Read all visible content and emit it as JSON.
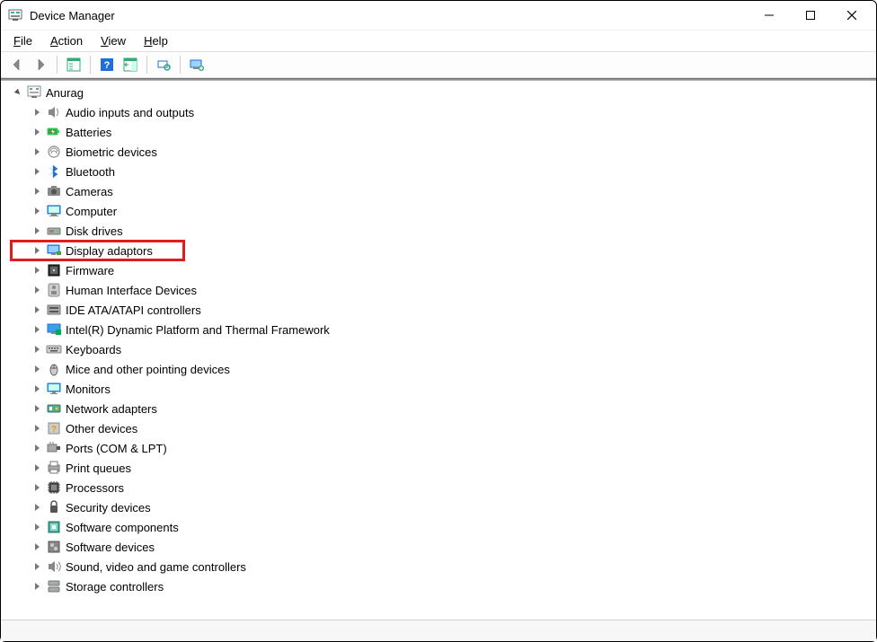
{
  "window": {
    "title": "Device Manager"
  },
  "menubar": {
    "file": "File",
    "action": "Action",
    "view": "View",
    "help": "Help"
  },
  "root": {
    "expanded": true,
    "label": "Anurag",
    "icon": "computer-root-icon"
  },
  "categories": [
    {
      "label": "Audio inputs and outputs",
      "icon": "audio-icon",
      "highlighted": false
    },
    {
      "label": "Batteries",
      "icon": "battery-icon",
      "highlighted": false
    },
    {
      "label": "Biometric devices",
      "icon": "biometric-icon",
      "highlighted": false
    },
    {
      "label": "Bluetooth",
      "icon": "bluetooth-icon",
      "highlighted": false
    },
    {
      "label": "Cameras",
      "icon": "camera-icon",
      "highlighted": false
    },
    {
      "label": "Computer",
      "icon": "computer-icon",
      "highlighted": false
    },
    {
      "label": "Disk drives",
      "icon": "disk-icon",
      "highlighted": false
    },
    {
      "label": "Display adaptors",
      "icon": "display-icon",
      "highlighted": true
    },
    {
      "label": "Firmware",
      "icon": "firmware-icon",
      "highlighted": false
    },
    {
      "label": "Human Interface Devices",
      "icon": "hid-icon",
      "highlighted": false
    },
    {
      "label": "IDE ATA/ATAPI controllers",
      "icon": "ide-icon",
      "highlighted": false
    },
    {
      "label": "Intel(R) Dynamic Platform and Thermal Framework",
      "icon": "intel-icon",
      "highlighted": false
    },
    {
      "label": "Keyboards",
      "icon": "keyboard-icon",
      "highlighted": false
    },
    {
      "label": "Mice and other pointing devices",
      "icon": "mouse-icon",
      "highlighted": false
    },
    {
      "label": "Monitors",
      "icon": "monitor-icon",
      "highlighted": false
    },
    {
      "label": "Network adapters",
      "icon": "network-icon",
      "highlighted": false
    },
    {
      "label": "Other devices",
      "icon": "other-icon",
      "highlighted": false
    },
    {
      "label": "Ports (COM & LPT)",
      "icon": "port-icon",
      "highlighted": false
    },
    {
      "label": "Print queues",
      "icon": "printer-icon",
      "highlighted": false
    },
    {
      "label": "Processors",
      "icon": "cpu-icon",
      "highlighted": false
    },
    {
      "label": "Security devices",
      "icon": "security-icon",
      "highlighted": false
    },
    {
      "label": "Software components",
      "icon": "software-comp-icon",
      "highlighted": false
    },
    {
      "label": "Software devices",
      "icon": "software-dev-icon",
      "highlighted": false
    },
    {
      "label": "Sound, video and game controllers",
      "icon": "sound-icon",
      "highlighted": false
    },
    {
      "label": "Storage controllers",
      "icon": "storage-icon",
      "highlighted": false
    }
  ]
}
